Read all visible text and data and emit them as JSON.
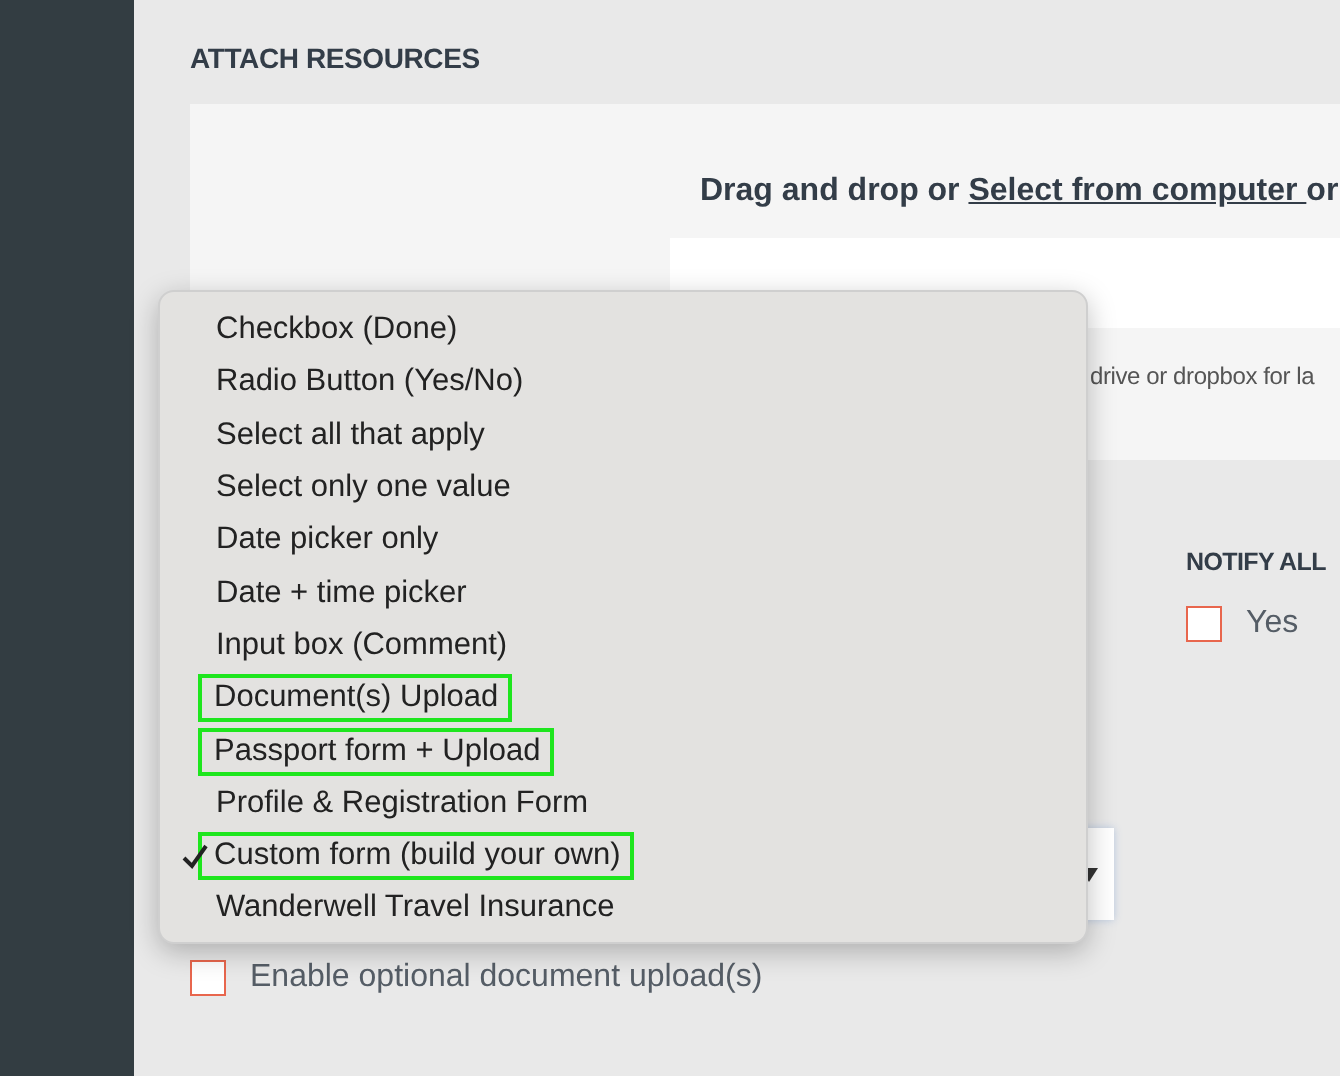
{
  "section_title": "ATTACH RESOURCES",
  "upload": {
    "prompt_before": "Drag and drop or ",
    "link": "Select from computer ",
    "prompt_after": "or",
    "hint": "drive or dropbox for la"
  },
  "notify": {
    "title": "NOTIFY ALL",
    "options": [
      {
        "label": "Yes",
        "checked": false
      }
    ]
  },
  "optional_upload": {
    "label": "Enable optional document upload(s)",
    "checked": false
  },
  "menu": {
    "items": [
      {
        "label": "Checkbox (Done)",
        "selected": false,
        "highlighted": false
      },
      {
        "label": "Radio Button (Yes/No)",
        "selected": false,
        "highlighted": false
      },
      {
        "label": "Select all that apply",
        "selected": false,
        "highlighted": false
      },
      {
        "label": "Select only one value",
        "selected": false,
        "highlighted": false
      },
      {
        "label": "Date picker only",
        "selected": false,
        "highlighted": false
      },
      {
        "label": "Date + time picker",
        "selected": false,
        "highlighted": false
      },
      {
        "label": "Input box (Comment)",
        "selected": false,
        "highlighted": false
      },
      {
        "label": "Document(s) Upload",
        "selected": false,
        "highlighted": true
      },
      {
        "label": "Passport form + Upload",
        "selected": false,
        "highlighted": true
      },
      {
        "label": "Profile & Registration Form",
        "selected": false,
        "highlighted": false
      },
      {
        "label": "Custom form (build your own)",
        "selected": true,
        "highlighted": true
      },
      {
        "label": "Wanderwell Travel Insurance",
        "selected": false,
        "highlighted": false
      }
    ]
  }
}
